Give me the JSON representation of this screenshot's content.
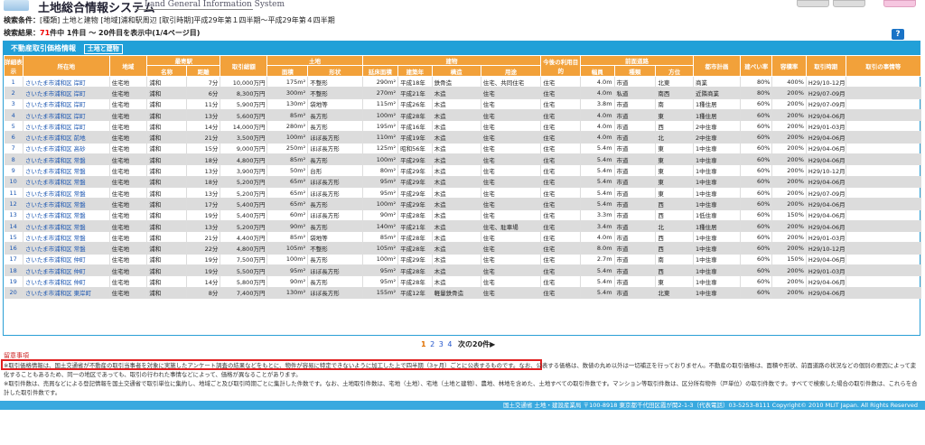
{
  "header": {
    "title": "土地総合情報システム",
    "subtitle": "Land General Information System"
  },
  "conditions": {
    "label": "検索条件：",
    "value": "[種類] 土地と建物 [地域]浦和駅周辺 [取引時期]平成29年第１四半期～平成29年第４四半期"
  },
  "result": {
    "label": "検索結果：",
    "count": "71",
    "text": "件中 1件目 ～ 20件目を表示中(1/4ページ目)"
  },
  "help_label": "?",
  "panel": {
    "title": "不動産取引価格情報",
    "tab_label": "土地と建物"
  },
  "headers": {
    "detail": "詳細表示",
    "location": "所在地",
    "area": "地域",
    "station": "最寄駅",
    "station_name": "名称",
    "distance": "距離",
    "price": "取引総額",
    "land": "土地",
    "land_area": "面積",
    "land_shape": "形状",
    "building": "建物",
    "floor_area": "延床面積",
    "built_year": "建築年",
    "structure": "構造",
    "use": "用途",
    "future_use": "今後の利用目的",
    "road": "前面道路",
    "road_width": "幅員",
    "road_type": "種類",
    "road_dir": "方位",
    "city_plan": "都市計画",
    "coverage": "建ぺい率",
    "far": "容積率",
    "time": "取引時期",
    "circumstances": "取引の事情等"
  },
  "rows": [
    {
      "no": "1",
      "loc": "さいたま市浦和区 岸町",
      "area": "住宅地",
      "st": "浦和",
      "dist": "7分",
      "price": "10,000万円",
      "la": "175m²",
      "shape": "不整形",
      "fa": "290m²",
      "yr": "平成18年",
      "str": "鉄骨造",
      "use": "住宅、共同住宅",
      "fut": "住宅",
      "rw": "4.0m",
      "rt": "市道",
      "rd": "北東",
      "cp": "商業",
      "cov": "80%",
      "far": "400%",
      "time": "H29/10-12月"
    },
    {
      "no": "2",
      "loc": "さいたま市浦和区 岸町",
      "area": "住宅地",
      "st": "浦和",
      "dist": "6分",
      "price": "8,300万円",
      "la": "300m²",
      "shape": "不整形",
      "fa": "270m²",
      "yr": "平成21年",
      "str": "木造",
      "use": "住宅",
      "fut": "住宅",
      "rw": "4.0m",
      "rt": "私道",
      "rd": "南西",
      "cp": "近隣商業",
      "cov": "80%",
      "far": "200%",
      "time": "H29/07-09月"
    },
    {
      "no": "3",
      "loc": "さいたま市浦和区 岸町",
      "area": "住宅地",
      "st": "浦和",
      "dist": "11分",
      "price": "5,900万円",
      "la": "130m²",
      "shape": "袋地等",
      "fa": "115m²",
      "yr": "平成26年",
      "str": "木造",
      "use": "住宅",
      "fut": "住宅",
      "rw": "3.8m",
      "rt": "市道",
      "rd": "南",
      "cp": "1種住居",
      "cov": "60%",
      "far": "200%",
      "time": "H29/07-09月"
    },
    {
      "no": "4",
      "loc": "さいたま市浦和区 岸町",
      "area": "住宅地",
      "st": "浦和",
      "dist": "13分",
      "price": "5,600万円",
      "la": "85m²",
      "shape": "長方形",
      "fa": "100m²",
      "yr": "平成28年",
      "str": "木造",
      "use": "住宅",
      "fut": "住宅",
      "rw": "4.0m",
      "rt": "市道",
      "rd": "東",
      "cp": "1種住居",
      "cov": "60%",
      "far": "200%",
      "time": "H29/04-06月"
    },
    {
      "no": "5",
      "loc": "さいたま市浦和区 岸町",
      "area": "住宅地",
      "st": "浦和",
      "dist": "14分",
      "price": "14,000万円",
      "la": "280m²",
      "shape": "長方形",
      "fa": "195m²",
      "yr": "平成16年",
      "str": "木造",
      "use": "住宅",
      "fut": "住宅",
      "rw": "4.0m",
      "rt": "市道",
      "rd": "西",
      "cp": "2中住専",
      "cov": "60%",
      "far": "200%",
      "time": "H29/01-03月"
    },
    {
      "no": "6",
      "loc": "さいたま市浦和区 前地",
      "area": "住宅地",
      "st": "浦和",
      "dist": "21分",
      "price": "3,500万円",
      "la": "100m²",
      "shape": "ほぼ長方形",
      "fa": "110m²",
      "yr": "平成19年",
      "str": "木造",
      "use": "住宅",
      "fut": "住宅",
      "rw": "4.0m",
      "rt": "市道",
      "rd": "北",
      "cp": "2中住専",
      "cov": "60%",
      "far": "200%",
      "time": "H29/04-06月"
    },
    {
      "no": "7",
      "loc": "さいたま市浦和区 高砂",
      "area": "住宅地",
      "st": "浦和",
      "dist": "15分",
      "price": "9,000万円",
      "la": "250m²",
      "shape": "ほぼ長方形",
      "fa": "125m²",
      "yr": "昭和56年",
      "str": "木造",
      "use": "住宅",
      "fut": "住宅",
      "rw": "5.4m",
      "rt": "市道",
      "rd": "東",
      "cp": "1中住専",
      "cov": "60%",
      "far": "200%",
      "time": "H29/04-06月"
    },
    {
      "no": "8",
      "loc": "さいたま市浦和区 常盤",
      "area": "住宅地",
      "st": "浦和",
      "dist": "18分",
      "price": "4,800万円",
      "la": "85m²",
      "shape": "長方形",
      "fa": "100m²",
      "yr": "平成29年",
      "str": "木造",
      "use": "住宅",
      "fut": "住宅",
      "rw": "5.4m",
      "rt": "市道",
      "rd": "東",
      "cp": "1中住専",
      "cov": "60%",
      "far": "200%",
      "time": "H29/04-06月"
    },
    {
      "no": "9",
      "loc": "さいたま市浦和区 常盤",
      "area": "住宅地",
      "st": "浦和",
      "dist": "13分",
      "price": "3,900万円",
      "la": "50m²",
      "shape": "台形",
      "fa": "80m²",
      "yr": "平成29年",
      "str": "木造",
      "use": "住宅",
      "fut": "住宅",
      "rw": "5.4m",
      "rt": "市道",
      "rd": "東",
      "cp": "1中住専",
      "cov": "60%",
      "far": "200%",
      "time": "H29/10-12月"
    },
    {
      "no": "10",
      "loc": "さいたま市浦和区 常盤",
      "area": "住宅地",
      "st": "浦和",
      "dist": "18分",
      "price": "5,200万円",
      "la": "65m²",
      "shape": "ほぼ長方形",
      "fa": "95m²",
      "yr": "平成29年",
      "str": "木造",
      "use": "住宅",
      "fut": "住宅",
      "rw": "5.4m",
      "rt": "市道",
      "rd": "東",
      "cp": "1中住専",
      "cov": "60%",
      "far": "200%",
      "time": "H29/04-06月"
    },
    {
      "no": "11",
      "loc": "さいたま市浦和区 常盤",
      "area": "住宅地",
      "st": "浦和",
      "dist": "13分",
      "price": "5,200万円",
      "la": "65m²",
      "shape": "ほぼ長方形",
      "fa": "95m²",
      "yr": "平成29年",
      "str": "木造",
      "use": "住宅",
      "fut": "住宅",
      "rw": "5.4m",
      "rt": "市道",
      "rd": "東",
      "cp": "1中住専",
      "cov": "60%",
      "far": "200%",
      "time": "H29/07-09月"
    },
    {
      "no": "12",
      "loc": "さいたま市浦和区 常盤",
      "area": "住宅地",
      "st": "浦和",
      "dist": "17分",
      "price": "5,400万円",
      "la": "65m²",
      "shape": "長方形",
      "fa": "100m²",
      "yr": "平成29年",
      "str": "木造",
      "use": "住宅",
      "fut": "住宅",
      "rw": "5.4m",
      "rt": "市道",
      "rd": "西",
      "cp": "1中住専",
      "cov": "60%",
      "far": "200%",
      "time": "H29/04-06月"
    },
    {
      "no": "13",
      "loc": "さいたま市浦和区 常盤",
      "area": "住宅地",
      "st": "浦和",
      "dist": "19分",
      "price": "5,400万円",
      "la": "60m²",
      "shape": "ほぼ長方形",
      "fa": "90m²",
      "yr": "平成28年",
      "str": "木造",
      "use": "住宅",
      "fut": "住宅",
      "rw": "3.3m",
      "rt": "市道",
      "rd": "西",
      "cp": "1低住専",
      "cov": "60%",
      "far": "150%",
      "time": "H29/04-06月"
    },
    {
      "no": "14",
      "loc": "さいたま市浦和区 常盤",
      "area": "住宅地",
      "st": "浦和",
      "dist": "13分",
      "price": "5,200万円",
      "la": "90m²",
      "shape": "長方形",
      "fa": "140m²",
      "yr": "平成21年",
      "str": "木造",
      "use": "住宅、駐車場",
      "fut": "住宅",
      "rw": "3.4m",
      "rt": "市道",
      "rd": "北",
      "cp": "1種住居",
      "cov": "60%",
      "far": "200%",
      "time": "H29/04-06月"
    },
    {
      "no": "15",
      "loc": "さいたま市浦和区 常盤",
      "area": "住宅地",
      "st": "浦和",
      "dist": "21分",
      "price": "4,400万円",
      "la": "85m²",
      "shape": "袋地等",
      "fa": "85m²",
      "yr": "平成28年",
      "str": "木造",
      "use": "住宅",
      "fut": "住宅",
      "rw": "4.0m",
      "rt": "市道",
      "rd": "西",
      "cp": "1中住専",
      "cov": "60%",
      "far": "200%",
      "time": "H29/01-03月"
    },
    {
      "no": "16",
      "loc": "さいたま市浦和区 常盤",
      "area": "住宅地",
      "st": "浦和",
      "dist": "22分",
      "price": "4,800万円",
      "la": "105m²",
      "shape": "不整形",
      "fa": "105m²",
      "yr": "平成28年",
      "str": "木造",
      "use": "住宅",
      "fut": "住宅",
      "rw": "8.0m",
      "rt": "市道",
      "rd": "西",
      "cp": "1中住専",
      "cov": "60%",
      "far": "200%",
      "time": "H29/10-12月"
    },
    {
      "no": "17",
      "loc": "さいたま市浦和区 仲町",
      "area": "住宅地",
      "st": "浦和",
      "dist": "19分",
      "price": "7,500万円",
      "la": "100m²",
      "shape": "長方形",
      "fa": "100m²",
      "yr": "平成29年",
      "str": "木造",
      "use": "住宅",
      "fut": "住宅",
      "rw": "2.7m",
      "rt": "市道",
      "rd": "南",
      "cp": "1中住専",
      "cov": "60%",
      "far": "150%",
      "time": "H29/04-06月"
    },
    {
      "no": "18",
      "loc": "さいたま市浦和区 仲町",
      "area": "住宅地",
      "st": "浦和",
      "dist": "19分",
      "price": "5,500万円",
      "la": "95m²",
      "shape": "ほぼ長方形",
      "fa": "95m²",
      "yr": "平成28年",
      "str": "木造",
      "use": "住宅",
      "fut": "住宅",
      "rw": "5.4m",
      "rt": "市道",
      "rd": "西",
      "cp": "1中住専",
      "cov": "60%",
      "far": "200%",
      "time": "H29/01-03月"
    },
    {
      "no": "19",
      "loc": "さいたま市浦和区 仲町",
      "area": "住宅地",
      "st": "浦和",
      "dist": "14分",
      "price": "5,800万円",
      "la": "90m²",
      "shape": "長方形",
      "fa": "95m²",
      "yr": "平成28年",
      "str": "木造",
      "use": "住宅",
      "fut": "住宅",
      "rw": "5.4m",
      "rt": "市道",
      "rd": "東",
      "cp": "1中住専",
      "cov": "60%",
      "far": "200%",
      "time": "H29/04-06月"
    },
    {
      "no": "20",
      "loc": "さいたま市浦和区 東岸町",
      "area": "住宅地",
      "st": "浦和",
      "dist": "8分",
      "price": "7,400万円",
      "la": "130m²",
      "shape": "ほぼ長方形",
      "fa": "155m²",
      "yr": "平成12年",
      "str": "軽量鉄骨造",
      "use": "住宅",
      "fut": "住宅",
      "rw": "5.4m",
      "rt": "市道",
      "rd": "北東",
      "cp": "1中住専",
      "cov": "60%",
      "far": "200%",
      "time": "H29/04-06月"
    }
  ],
  "pager": {
    "current": "1",
    "p2": "2",
    "p3": "3",
    "p4": "4",
    "next": "次の20件▶"
  },
  "notes": {
    "title": "留意事項",
    "line1": "※取引価格情報は、国土交通省が不動産の取引当事者を対象に実施したアンケート調査の結果などをもとに、物件が容易に特定できないように加工した上で四半期（3ヶ月）ごとに公表するものです。",
    "line1b": "なお、公表する価格は、数値の丸め以外は一切補正を行っておりません。不動産の取引価格は、面積や形状、前面道路の状況などの個別の要因によって変化することもあるため、同一の地区であっても、取引の行われた事情などによって、価格が異なることがあります。",
    "line2": "※取引件数は、売買などによる登記情報を国土交通省で取引単位に集約し、地域ごと及び取引時期ごとに集計した件数です。なお、土地取引件数は、宅地（土地）、宅地（土地と建物）、農地、林地を含めた、土地すべての取引件数です。マンション等取引件数は、区分所有物件（戸単位）の取引件数です。すべてで検索した場合の取引件数は、これらを合計した取引件数です。"
  },
  "footer": "国土交通省 土地・建設産業局 〒100-8918 東京都千代田区霞が関2-1-3（代表電話）03-5253-8111 Copyright© 2010 MLIT Japan. All Rights Reserved",
  "colors": {
    "header_orange": "#f2a13a",
    "panel_blue": "#21a0d8",
    "highlight_red": "#e02020"
  }
}
